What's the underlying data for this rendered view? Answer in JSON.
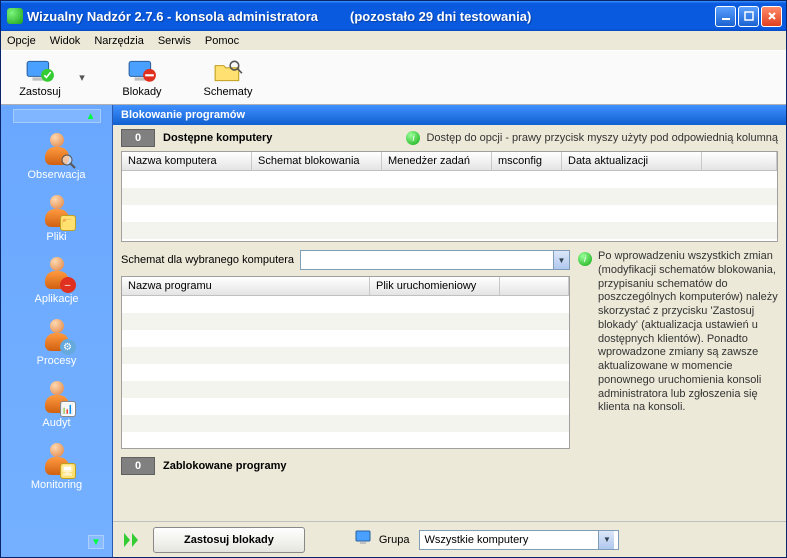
{
  "title": {
    "app": "Wizualny Nadzór 2.7.6 - konsola administratora",
    "trial": "(pozostało 29 dni testowania)"
  },
  "menu": {
    "opcje": "Opcje",
    "widok": "Widok",
    "narzedzia": "Narzędzia",
    "serwis": "Serwis",
    "pomoc": "Pomoc"
  },
  "toolbar": {
    "zastosuj": "Zastosuj",
    "blokady": "Blokady",
    "schematy": "Schematy"
  },
  "sidebar": {
    "items": [
      {
        "label": "Obserwacja"
      },
      {
        "label": "Pliki"
      },
      {
        "label": "Aplikacje"
      },
      {
        "label": "Procesy"
      },
      {
        "label": "Audyt"
      },
      {
        "label": "Monitoring"
      }
    ]
  },
  "pane": {
    "title": "Blokowanie programów"
  },
  "section_available": {
    "count": "0",
    "title": "Dostępne komputery",
    "hint": "Dostęp do opcji - prawy przycisk myszy użyty pod odpowiednią kolumną",
    "columns": {
      "c1": "Nazwa komputera",
      "c2": "Schemat blokowania",
      "c3": "Menedżer zadań",
      "c4": "msconfig",
      "c5": "Data aktualizacji"
    }
  },
  "schema_select": {
    "label": "Schemat dla wybranego komputera"
  },
  "programs_grid": {
    "columns": {
      "c1": "Nazwa programu",
      "c2": "Plik uruchomieniowy"
    }
  },
  "info_text": "Po wprowadzeniu wszystkich zmian (modyfikacji schematów blokowania, przypisaniu schematów do poszczególnych komputerów) należy skorzystać z przycisku 'Zastosuj blokady' (aktualizacja ustawień u dostępnych klientów). Ponadto wprowadzone zmiany są zawsze aktualizowane w momencie ponownego uruchomienia konsoli administratora lub zgłoszenia się klienta na konsoli.",
  "section_blocked": {
    "count": "0",
    "title": "Zablokowane programy"
  },
  "footer": {
    "apply": "Zastosuj blokady",
    "group_label": "Grupa",
    "group_value": "Wszystkie komputery"
  }
}
